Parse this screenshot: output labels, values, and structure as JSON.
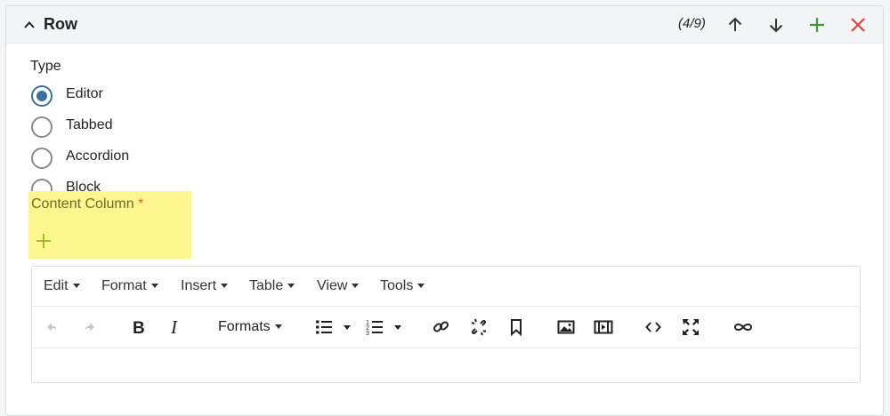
{
  "panel": {
    "title": "Row",
    "position": "(4/9)",
    "icons": [
      "chevron-up-icon",
      "arrow-up-icon",
      "arrow-down-icon",
      "plus-icon",
      "close-icon"
    ],
    "colors": {
      "add": "#3a9a3a",
      "remove": "#d9463e",
      "radio_selected": "#3b6fa0",
      "highlight": "#fff68f"
    }
  },
  "type_field": {
    "label": "Type",
    "options": [
      {
        "label": "Editor",
        "selected": true
      },
      {
        "label": "Tabbed",
        "selected": false
      },
      {
        "label": "Accordion",
        "selected": false
      },
      {
        "label": "Block",
        "selected": false
      }
    ]
  },
  "content_column": {
    "label": "Content Column",
    "required_marker": "*"
  },
  "editor": {
    "menus": [
      "Edit",
      "Format",
      "Insert",
      "Table",
      "View",
      "Tools"
    ],
    "formats_label": "Formats",
    "toolbar_icons": [
      "undo-icon",
      "redo-icon",
      "bold-icon",
      "italic-icon",
      "bullet-list-icon",
      "numbered-list-icon",
      "link-icon",
      "unlink-icon",
      "bookmark-icon",
      "image-icon",
      "media-icon",
      "code-icon",
      "fullscreen-icon",
      "infinity-icon"
    ]
  }
}
